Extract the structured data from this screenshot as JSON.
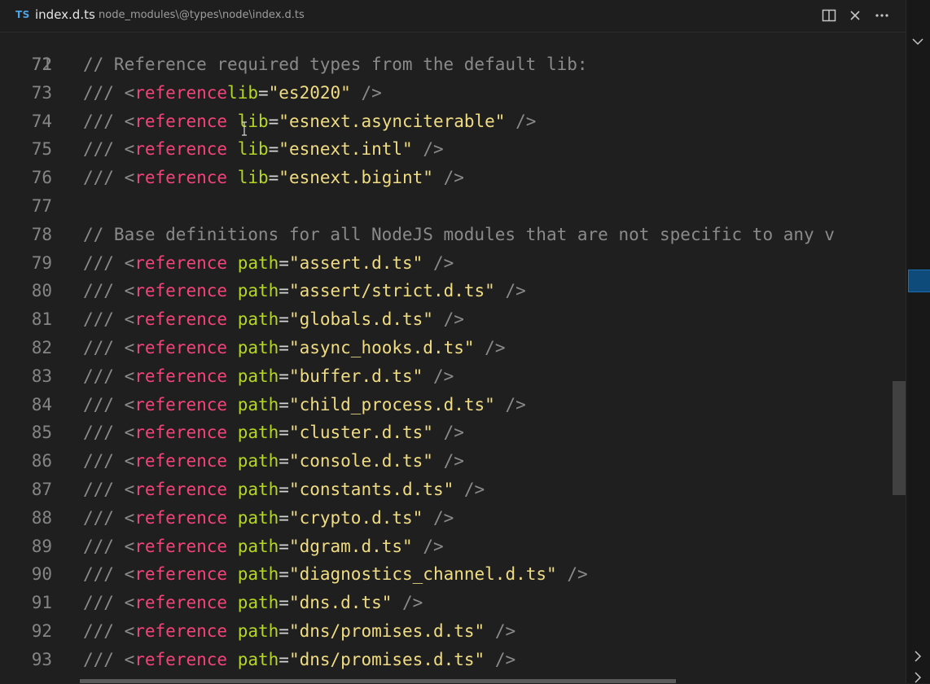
{
  "tab": {
    "language_badge": "TS",
    "file_name": "index.d.ts",
    "file_path": "node_modules\\@types\\node\\index.d.ts"
  },
  "icons": {
    "split": "split-editor-icon",
    "close": "close-icon",
    "more": "more-actions-icon"
  },
  "colors": {
    "background": "#1f1f1f",
    "comment": "#8a8a8a",
    "tag": "#f2447a",
    "attribute": "#b4d624",
    "string": "#f0dc82",
    "line_number": "#858585"
  },
  "editor": {
    "partial_top_line": "71",
    "lines": [
      {
        "n": "72",
        "comment": "// Reference required types from the default lib:"
      },
      {
        "n": "73",
        "slash": "///",
        "lt": "<",
        "tag": "reference",
        "sp": "",
        "attr": "lib",
        "eq": "=",
        "val": "\"es2020\"",
        "end": "/>"
      },
      {
        "n": "74",
        "slash": "///",
        "lt": "<",
        "tag": "reference",
        "sp": " ",
        "attr": "lib",
        "eq": "=",
        "val": "\"esnext.asynciterable\"",
        "end": "/>"
      },
      {
        "n": "75",
        "slash": "///",
        "lt": "<",
        "tag": "reference",
        "sp": " ",
        "attr": "lib",
        "eq": "=",
        "val": "\"esnext.intl\"",
        "end": "/>"
      },
      {
        "n": "76",
        "slash": "///",
        "lt": "<",
        "tag": "reference",
        "sp": " ",
        "attr": "lib",
        "eq": "=",
        "val": "\"esnext.bigint\"",
        "end": "/>"
      },
      {
        "n": "77",
        "comment": ""
      },
      {
        "n": "78",
        "comment": "// Base definitions for all NodeJS modules that are not specific to any v"
      },
      {
        "n": "79",
        "slash": "///",
        "lt": "<",
        "tag": "reference",
        "sp": " ",
        "attr": "path",
        "eq": "=",
        "val": "\"assert.d.ts\"",
        "end": "/>"
      },
      {
        "n": "80",
        "slash": "///",
        "lt": "<",
        "tag": "reference",
        "sp": " ",
        "attr": "path",
        "eq": "=",
        "val": "\"assert/strict.d.ts\"",
        "end": "/>"
      },
      {
        "n": "81",
        "slash": "///",
        "lt": "<",
        "tag": "reference",
        "sp": " ",
        "attr": "path",
        "eq": "=",
        "val": "\"globals.d.ts\"",
        "end": "/>"
      },
      {
        "n": "82",
        "slash": "///",
        "lt": "<",
        "tag": "reference",
        "sp": " ",
        "attr": "path",
        "eq": "=",
        "val": "\"async_hooks.d.ts\"",
        "end": "/>"
      },
      {
        "n": "83",
        "slash": "///",
        "lt": "<",
        "tag": "reference",
        "sp": " ",
        "attr": "path",
        "eq": "=",
        "val": "\"buffer.d.ts\"",
        "end": "/>"
      },
      {
        "n": "84",
        "slash": "///",
        "lt": "<",
        "tag": "reference",
        "sp": " ",
        "attr": "path",
        "eq": "=",
        "val": "\"child_process.d.ts\"",
        "end": "/>"
      },
      {
        "n": "85",
        "slash": "///",
        "lt": "<",
        "tag": "reference",
        "sp": " ",
        "attr": "path",
        "eq": "=",
        "val": "\"cluster.d.ts\"",
        "end": "/>"
      },
      {
        "n": "86",
        "slash": "///",
        "lt": "<",
        "tag": "reference",
        "sp": " ",
        "attr": "path",
        "eq": "=",
        "val": "\"console.d.ts\"",
        "end": "/>"
      },
      {
        "n": "87",
        "slash": "///",
        "lt": "<",
        "tag": "reference",
        "sp": " ",
        "attr": "path",
        "eq": "=",
        "val": "\"constants.d.ts\"",
        "end": "/>"
      },
      {
        "n": "88",
        "slash": "///",
        "lt": "<",
        "tag": "reference",
        "sp": " ",
        "attr": "path",
        "eq": "=",
        "val": "\"crypto.d.ts\"",
        "end": "/>"
      },
      {
        "n": "89",
        "slash": "///",
        "lt": "<",
        "tag": "reference",
        "sp": " ",
        "attr": "path",
        "eq": "=",
        "val": "\"dgram.d.ts\"",
        "end": "/>"
      },
      {
        "n": "90",
        "slash": "///",
        "lt": "<",
        "tag": "reference",
        "sp": " ",
        "attr": "path",
        "eq": "=",
        "val": "\"diagnostics_channel.d.ts\"",
        "end": "/>"
      },
      {
        "n": "91",
        "slash": "///",
        "lt": "<",
        "tag": "reference",
        "sp": " ",
        "attr": "path",
        "eq": "=",
        "val": "\"dns.d.ts\"",
        "end": "/>"
      },
      {
        "n": "92",
        "slash": "///",
        "lt": "<",
        "tag": "reference",
        "sp": " ",
        "attr": "path",
        "eq": "=",
        "val": "\"dns/promises.d.ts\"",
        "end": "/>"
      },
      {
        "n": "93",
        "slash": "///",
        "lt": "<",
        "tag": "reference",
        "sp": " ",
        "attr": "path",
        "eq": "=",
        "val": "\"dns/promises.d.ts\"",
        "end": "/>"
      }
    ]
  }
}
